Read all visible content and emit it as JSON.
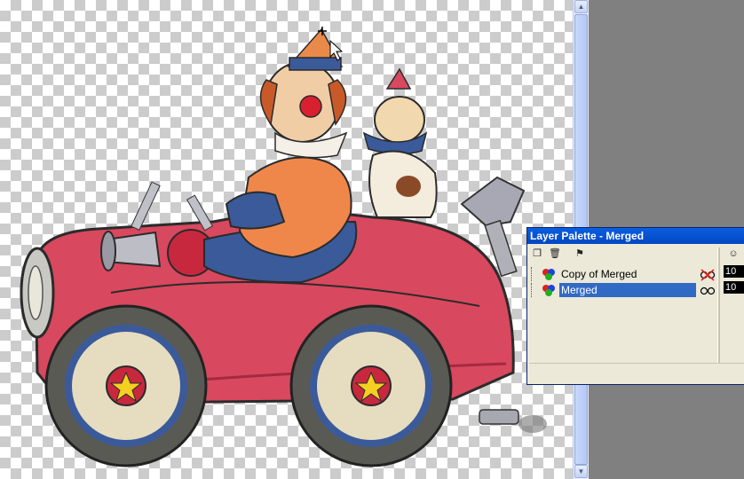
{
  "palette": {
    "title": "Layer Palette - Merged",
    "layers": [
      {
        "name": "Copy of Merged",
        "selected": false,
        "visibility": "hidden-icon"
      },
      {
        "name": "Merged",
        "selected": true,
        "visibility": "visible-icon"
      }
    ],
    "opacity": [
      "10",
      "10"
    ]
  },
  "colors": {
    "titlebar": "#0446c2",
    "selection": "#316ac5",
    "panel_bg": "#ece9d8",
    "workspace": "#808080"
  }
}
